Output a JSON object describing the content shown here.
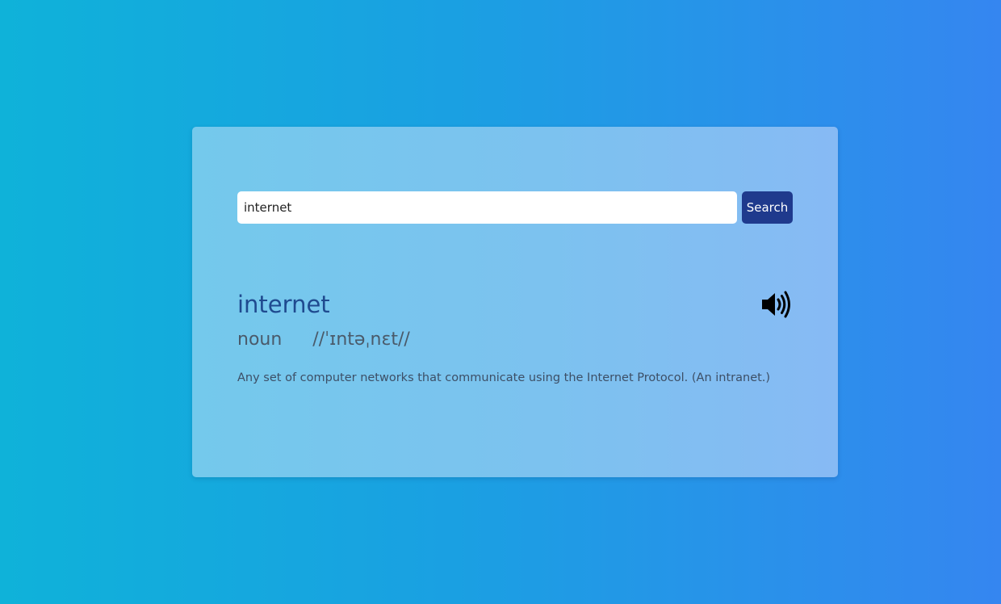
{
  "search": {
    "value": "internet",
    "button_label": "Search"
  },
  "result": {
    "word": "internet",
    "part_of_speech": "noun",
    "phonetic": "//ˈɪntəˌnɛt//",
    "definition": "Any set of computer networks that communicate using the Internet Protocol. (An intranet.)",
    "audio_icon": "speaker-volume-icon"
  },
  "colors": {
    "background_start": "#0fb2d9",
    "background_end": "#3586f0",
    "card": "#7cc2ef",
    "button": "#1f3a8d",
    "word": "#1f4a8f"
  }
}
